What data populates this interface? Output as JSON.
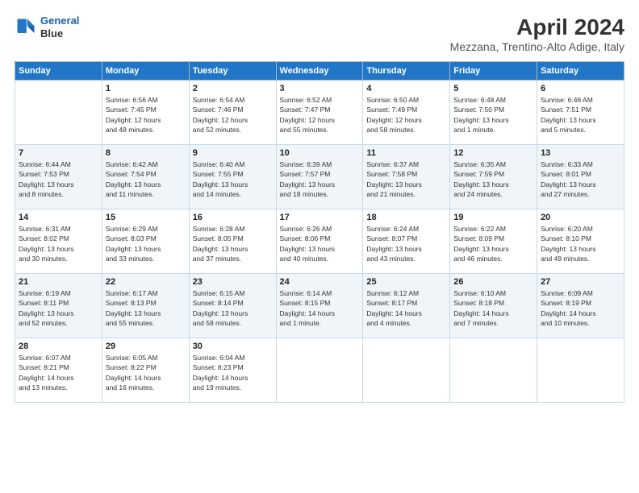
{
  "header": {
    "logo_line1": "General",
    "logo_line2": "Blue",
    "title": "April 2024",
    "subtitle": "Mezzana, Trentino-Alto Adige, Italy"
  },
  "days_of_week": [
    "Sunday",
    "Monday",
    "Tuesday",
    "Wednesday",
    "Thursday",
    "Friday",
    "Saturday"
  ],
  "weeks": [
    [
      {
        "day": "",
        "info": ""
      },
      {
        "day": "1",
        "info": "Sunrise: 6:56 AM\nSunset: 7:45 PM\nDaylight: 12 hours\nand 48 minutes."
      },
      {
        "day": "2",
        "info": "Sunrise: 6:54 AM\nSunset: 7:46 PM\nDaylight: 12 hours\nand 52 minutes."
      },
      {
        "day": "3",
        "info": "Sunrise: 6:52 AM\nSunset: 7:47 PM\nDaylight: 12 hours\nand 55 minutes."
      },
      {
        "day": "4",
        "info": "Sunrise: 6:50 AM\nSunset: 7:49 PM\nDaylight: 12 hours\nand 58 minutes."
      },
      {
        "day": "5",
        "info": "Sunrise: 6:48 AM\nSunset: 7:50 PM\nDaylight: 13 hours\nand 1 minute."
      },
      {
        "day": "6",
        "info": "Sunrise: 6:46 AM\nSunset: 7:51 PM\nDaylight: 13 hours\nand 5 minutes."
      }
    ],
    [
      {
        "day": "7",
        "info": "Sunrise: 6:44 AM\nSunset: 7:53 PM\nDaylight: 13 hours\nand 8 minutes."
      },
      {
        "day": "8",
        "info": "Sunrise: 6:42 AM\nSunset: 7:54 PM\nDaylight: 13 hours\nand 11 minutes."
      },
      {
        "day": "9",
        "info": "Sunrise: 6:40 AM\nSunset: 7:55 PM\nDaylight: 13 hours\nand 14 minutes."
      },
      {
        "day": "10",
        "info": "Sunrise: 6:39 AM\nSunset: 7:57 PM\nDaylight: 13 hours\nand 18 minutes."
      },
      {
        "day": "11",
        "info": "Sunrise: 6:37 AM\nSunset: 7:58 PM\nDaylight: 13 hours\nand 21 minutes."
      },
      {
        "day": "12",
        "info": "Sunrise: 6:35 AM\nSunset: 7:59 PM\nDaylight: 13 hours\nand 24 minutes."
      },
      {
        "day": "13",
        "info": "Sunrise: 6:33 AM\nSunset: 8:01 PM\nDaylight: 13 hours\nand 27 minutes."
      }
    ],
    [
      {
        "day": "14",
        "info": "Sunrise: 6:31 AM\nSunset: 8:02 PM\nDaylight: 13 hours\nand 30 minutes."
      },
      {
        "day": "15",
        "info": "Sunrise: 6:29 AM\nSunset: 8:03 PM\nDaylight: 13 hours\nand 33 minutes."
      },
      {
        "day": "16",
        "info": "Sunrise: 6:28 AM\nSunset: 8:05 PM\nDaylight: 13 hours\nand 37 minutes."
      },
      {
        "day": "17",
        "info": "Sunrise: 6:26 AM\nSunset: 8:06 PM\nDaylight: 13 hours\nand 40 minutes."
      },
      {
        "day": "18",
        "info": "Sunrise: 6:24 AM\nSunset: 8:07 PM\nDaylight: 13 hours\nand 43 minutes."
      },
      {
        "day": "19",
        "info": "Sunrise: 6:22 AM\nSunset: 8:09 PM\nDaylight: 13 hours\nand 46 minutes."
      },
      {
        "day": "20",
        "info": "Sunrise: 6:20 AM\nSunset: 8:10 PM\nDaylight: 13 hours\nand 49 minutes."
      }
    ],
    [
      {
        "day": "21",
        "info": "Sunrise: 6:19 AM\nSunset: 8:11 PM\nDaylight: 13 hours\nand 52 minutes."
      },
      {
        "day": "22",
        "info": "Sunrise: 6:17 AM\nSunset: 8:13 PM\nDaylight: 13 hours\nand 55 minutes."
      },
      {
        "day": "23",
        "info": "Sunrise: 6:15 AM\nSunset: 8:14 PM\nDaylight: 13 hours\nand 58 minutes."
      },
      {
        "day": "24",
        "info": "Sunrise: 6:14 AM\nSunset: 8:15 PM\nDaylight: 14 hours\nand 1 minute."
      },
      {
        "day": "25",
        "info": "Sunrise: 6:12 AM\nSunset: 8:17 PM\nDaylight: 14 hours\nand 4 minutes."
      },
      {
        "day": "26",
        "info": "Sunrise: 6:10 AM\nSunset: 8:18 PM\nDaylight: 14 hours\nand 7 minutes."
      },
      {
        "day": "27",
        "info": "Sunrise: 6:09 AM\nSunset: 8:19 PM\nDaylight: 14 hours\nand 10 minutes."
      }
    ],
    [
      {
        "day": "28",
        "info": "Sunrise: 6:07 AM\nSunset: 8:21 PM\nDaylight: 14 hours\nand 13 minutes."
      },
      {
        "day": "29",
        "info": "Sunrise: 6:05 AM\nSunset: 8:22 PM\nDaylight: 14 hours\nand 16 minutes."
      },
      {
        "day": "30",
        "info": "Sunrise: 6:04 AM\nSunset: 8:23 PM\nDaylight: 14 hours\nand 19 minutes."
      },
      {
        "day": "",
        "info": ""
      },
      {
        "day": "",
        "info": ""
      },
      {
        "day": "",
        "info": ""
      },
      {
        "day": "",
        "info": ""
      }
    ]
  ]
}
